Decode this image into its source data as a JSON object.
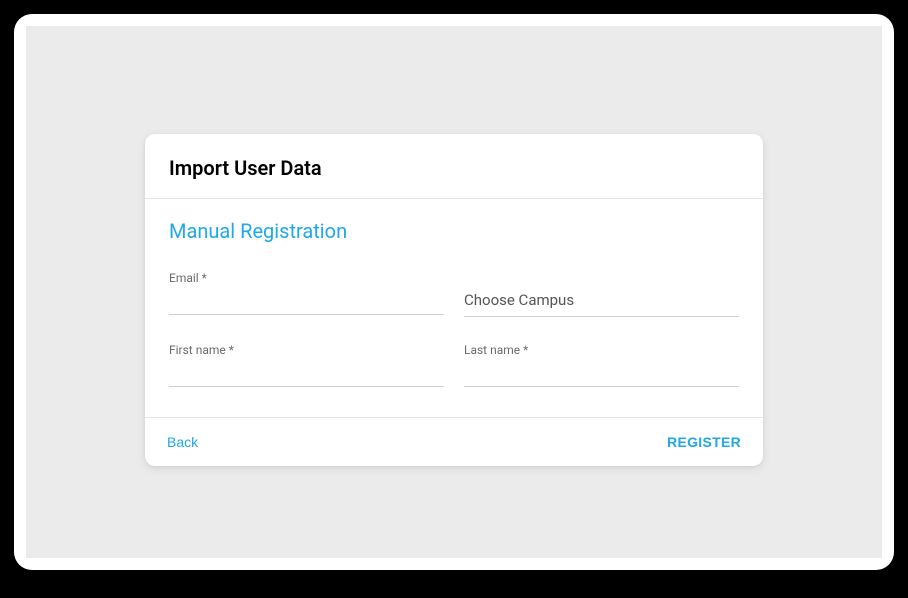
{
  "header": {
    "title": "Import User Data"
  },
  "section": {
    "title": "Manual Registration"
  },
  "fields": {
    "email": {
      "label": "Email *",
      "value": ""
    },
    "campus": {
      "placeholder": "Choose Campus",
      "value": ""
    },
    "firstName": {
      "label": "First name *",
      "value": ""
    },
    "lastName": {
      "label": "Last name *",
      "value": ""
    }
  },
  "footer": {
    "back": "Back",
    "register": "REGISTER"
  }
}
